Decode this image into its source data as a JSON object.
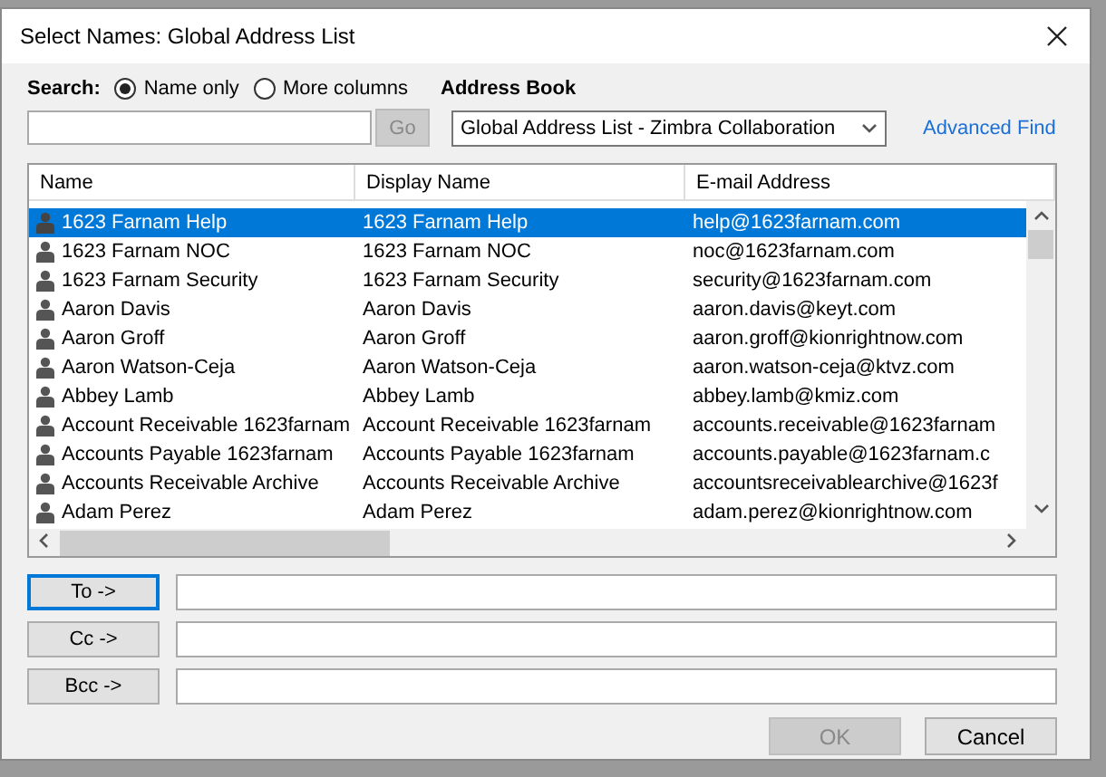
{
  "window": {
    "title": "Select Names: Global Address List"
  },
  "search": {
    "label": "Search:",
    "options": [
      {
        "label": "Name only",
        "selected": true
      },
      {
        "label": "More columns",
        "selected": false
      }
    ],
    "go_button": {
      "label": "Go",
      "disabled": true
    }
  },
  "address_book": {
    "label": "Address Book",
    "value": "Global Address List - Zimbra Collaboration",
    "advanced_find": "Advanced Find"
  },
  "table": {
    "columns": [
      "Name",
      "Display Name",
      "E-mail Address"
    ],
    "rows": [
      {
        "name": "1623 Farnam Help",
        "display": "1623 Farnam Help",
        "email": "help@1623farnam.com",
        "selected": true
      },
      {
        "name": "1623 Farnam NOC",
        "display": "1623 Farnam NOC",
        "email": "noc@1623farnam.com",
        "selected": false
      },
      {
        "name": "1623 Farnam Security",
        "display": "1623 Farnam Security",
        "email": "security@1623farnam.com",
        "selected": false
      },
      {
        "name": "Aaron Davis",
        "display": "Aaron Davis",
        "email": "aaron.davis@keyt.com",
        "selected": false
      },
      {
        "name": "Aaron Groff",
        "display": "Aaron Groff",
        "email": "aaron.groff@kionrightnow.com",
        "selected": false
      },
      {
        "name": "Aaron Watson-Ceja",
        "display": "Aaron Watson-Ceja",
        "email": "aaron.watson-ceja@ktvz.com",
        "selected": false
      },
      {
        "name": "Abbey Lamb",
        "display": "Abbey Lamb",
        "email": "abbey.lamb@kmiz.com",
        "selected": false
      },
      {
        "name": "Account Receivable 1623farnam",
        "display": "Account Receivable 1623farnam",
        "email": "accounts.receivable@1623farnam",
        "selected": false
      },
      {
        "name": "Accounts Payable 1623farnam",
        "display": "Accounts Payable 1623farnam",
        "email": "accounts.payable@1623farnam.c",
        "selected": false
      },
      {
        "name": "Accounts Receivable Archive",
        "display": "Accounts Receivable Archive",
        "email": "accountsreceivablearchive@1623f",
        "selected": false
      },
      {
        "name": "Adam Perez",
        "display": "Adam Perez",
        "email": "adam.perez@kionrightnow.com",
        "selected": false
      }
    ]
  },
  "recipients": [
    {
      "label": "To ->",
      "focused": true
    },
    {
      "label": "Cc ->",
      "focused": false
    },
    {
      "label": "Bcc ->",
      "focused": false
    }
  ],
  "buttons": [
    {
      "label": "OK",
      "disabled": true
    },
    {
      "label": "Cancel",
      "disabled": false
    }
  ]
}
